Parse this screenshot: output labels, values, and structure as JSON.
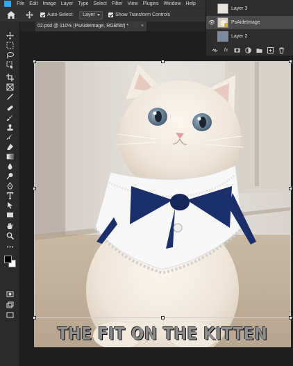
{
  "menubar": {
    "items": [
      "File",
      "Edit",
      "Image",
      "Layer",
      "Type",
      "Select",
      "Filter",
      "View",
      "Plugins",
      "Window",
      "Help"
    ]
  },
  "options_bar": {
    "auto_select_label": "Auto-Select:",
    "auto_select_target": "Layer",
    "transform_controls_label": "Show Transform Controls"
  },
  "document": {
    "tab_title": "02.psd @ 110% (PsAideImage, RGB/8#) *",
    "close_glyph": "×"
  },
  "layers": [
    {
      "name": "Layer 3",
      "selected": false,
      "visible_eye": false
    },
    {
      "name": "PsAideImage",
      "selected": true,
      "visible_eye": true
    },
    {
      "name": "Layer 2",
      "selected": false,
      "visible_eye": false
    }
  ],
  "layers_footer": {
    "icons": [
      "link-icon",
      "fx-icon",
      "mask-icon",
      "adjustment-icon",
      "group-folder-icon",
      "new-layer-icon",
      "trash-icon"
    ],
    "fx_label": "fx"
  },
  "canvas": {
    "caption": "THE FIT ON THE KITTEN"
  },
  "colors": {
    "accent": "#31a8ff",
    "collar_bow": "#1b2f6b",
    "panel_bg": "#2d2d2d"
  }
}
